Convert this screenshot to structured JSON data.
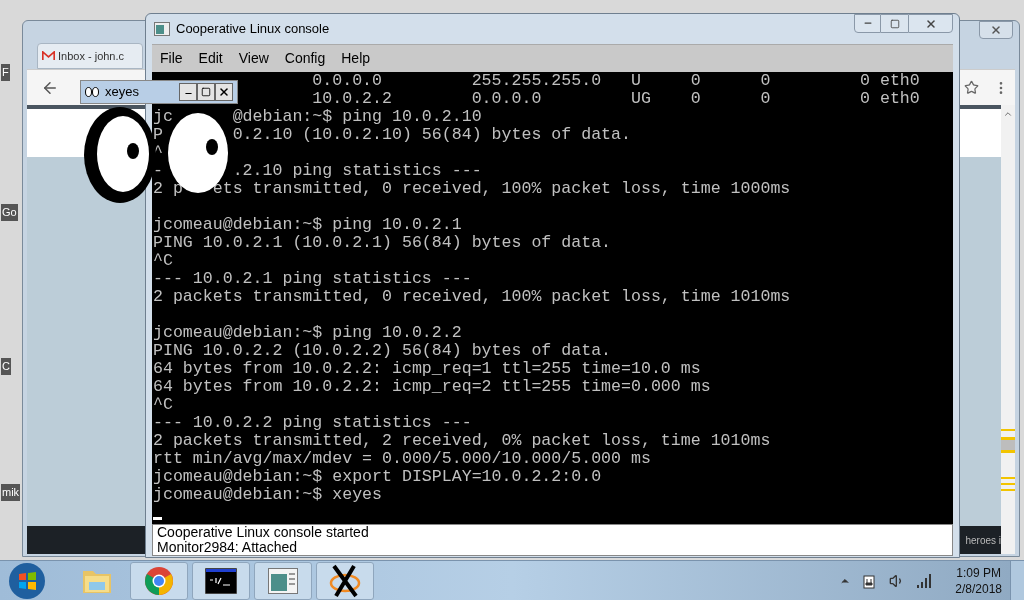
{
  "desktop_icons": [
    {
      "label": "F"
    },
    {
      "label": "Go"
    },
    {
      "label": "C"
    },
    {
      "label": "mik"
    }
  ],
  "browser": {
    "tab_title": "Inbox - john.c",
    "page_text": "heroes i"
  },
  "console": {
    "title": "Cooperative Linux console",
    "menu": [
      "File",
      "Edit",
      "View",
      "Config",
      "Help"
    ],
    "terminal_blocks": [
      [
        "                0.0.0.0         255.255.255.0   U     0      0         0 eth0",
        "                10.0.2.2        0.0.0.0         UG    0      0         0 eth0",
        "jc      @debian:~$ ping 10.0.2.10",
        "P       0.2.10 (10.0.2.10) 56(84) bytes of data.",
        "^",
        "-       .2.10 ping statistics ---",
        "2 p   ets transmitted, 0 received, 100% packet loss, time 1000ms"
      ],
      [
        "jcomeau@debian:~$ ping 10.0.2.1",
        "PING 10.0.2.1 (10.0.2.1) 56(84) bytes of data.",
        "^C",
        "--- 10.0.2.1 ping statistics ---",
        "2 packets transmitted, 0 received, 100% packet loss, time 1010ms"
      ],
      [
        "jcomeau@debian:~$ ping 10.0.2.2",
        "PING 10.0.2.2 (10.0.2.2) 56(84) bytes of data.",
        "64 bytes from 10.0.2.2: icmp_req=1 ttl=255 time=10.0 ms",
        "64 bytes from 10.0.2.2: icmp_req=2 ttl=255 time=0.000 ms",
        "^C",
        "--- 10.0.2.2 ping statistics ---",
        "2 packets transmitted, 2 received, 0% packet loss, time 1010ms",
        "rtt min/avg/max/mdev = 0.000/5.000/10.000/5.000 ms",
        "jcomeau@debian:~$ export DISPLAY=10.0.2.2:0.0",
        "jcomeau@debian:~$ xeyes"
      ]
    ],
    "status_lines": [
      "Cooperative Linux console started",
      "Monitor2984: Attached"
    ]
  },
  "xeyes": {
    "title": "xeyes"
  },
  "taskbar": {
    "apps": [
      {
        "kind": "explorer"
      },
      {
        "kind": "chrome"
      },
      {
        "kind": "console"
      },
      {
        "kind": "window"
      },
      {
        "kind": "x"
      }
    ],
    "time": "1:09 PM",
    "date": "2/8/2018"
  }
}
